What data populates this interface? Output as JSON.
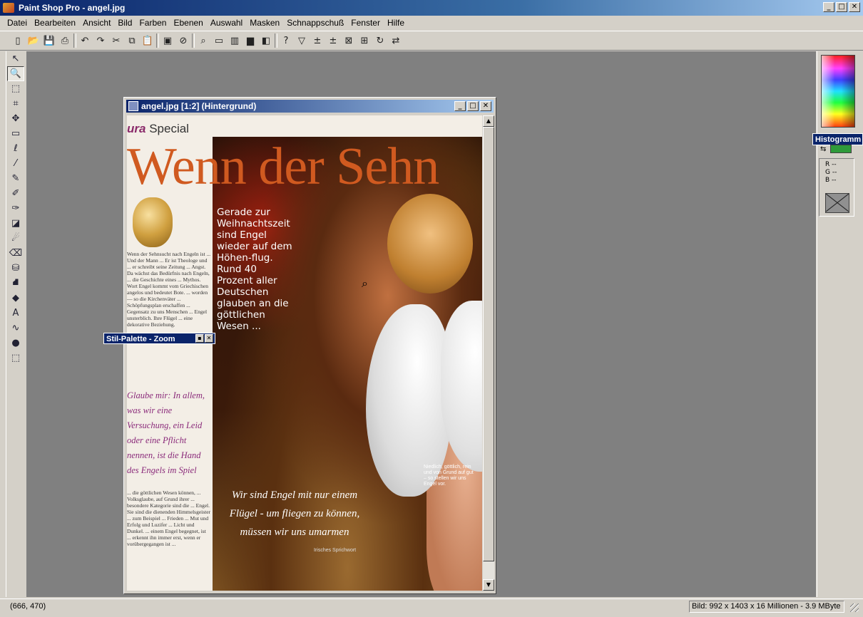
{
  "app": {
    "title": "Paint Shop Pro - angel.jpg"
  },
  "menu": [
    "Datei",
    "Bearbeiten",
    "Ansicht",
    "Bild",
    "Farben",
    "Ebenen",
    "Auswahl",
    "Masken",
    "Schnappschuß",
    "Fenster",
    "Hilfe"
  ],
  "toolbar_icons": [
    {
      "name": "new-icon",
      "glyph": "▯"
    },
    {
      "name": "open-icon",
      "glyph": "📂"
    },
    {
      "name": "save-icon",
      "glyph": "💾"
    },
    {
      "name": "print-icon",
      "glyph": "⎙"
    },
    {
      "name": "sep"
    },
    {
      "name": "undo-icon",
      "glyph": "↶"
    },
    {
      "name": "redo-icon",
      "glyph": "↷"
    },
    {
      "name": "cut-icon",
      "glyph": "✂"
    },
    {
      "name": "copy-icon",
      "glyph": "⧉"
    },
    {
      "name": "paste-icon",
      "glyph": "📋"
    },
    {
      "name": "sep"
    },
    {
      "name": "full-screen-icon",
      "glyph": "▣"
    },
    {
      "name": "normal-view-icon",
      "glyph": "⊘"
    },
    {
      "name": "sep"
    },
    {
      "name": "zoom-toggle-icon",
      "glyph": "⌕"
    },
    {
      "name": "toolbar-toggle-icon",
      "glyph": "▭"
    },
    {
      "name": "color-palette-icon",
      "glyph": "▥"
    },
    {
      "name": "histogram-icon",
      "glyph": "▆"
    },
    {
      "name": "layer-palette-icon",
      "glyph": "◧"
    },
    {
      "name": "sep"
    },
    {
      "name": "context-help-icon",
      "glyph": "?"
    },
    {
      "name": "filter-icon",
      "glyph": "▽"
    },
    {
      "name": "brightness-icon",
      "glyph": "±"
    },
    {
      "name": "contrast-icon",
      "glyph": "±"
    },
    {
      "name": "grid-icon",
      "glyph": "⊠"
    },
    {
      "name": "lock-icon",
      "glyph": "⊞"
    },
    {
      "name": "rotate-icon",
      "glyph": "↻"
    },
    {
      "name": "resize-icon",
      "glyph": "⇄"
    }
  ],
  "tools": [
    {
      "name": "arrow-tool-icon",
      "glyph": "↖"
    },
    {
      "name": "zoom-tool-icon",
      "glyph": "🔍",
      "active": true
    },
    {
      "name": "deform-tool-icon",
      "glyph": "⬚"
    },
    {
      "name": "crop-tool-icon",
      "glyph": "⌗"
    },
    {
      "name": "mover-tool-icon",
      "glyph": "✥"
    },
    {
      "name": "selection-tool-icon",
      "glyph": "▭"
    },
    {
      "name": "freehand-tool-icon",
      "glyph": "ℓ"
    },
    {
      "name": "dropper-tool-icon",
      "glyph": "⁄"
    },
    {
      "name": "paintbrush-tool-icon",
      "glyph": "✎"
    },
    {
      "name": "clone-tool-icon",
      "glyph": "✐"
    },
    {
      "name": "scratch-remover-icon",
      "glyph": "✑"
    },
    {
      "name": "color-replacer-icon",
      "glyph": "◪"
    },
    {
      "name": "retouch-tool-icon",
      "glyph": "☄"
    },
    {
      "name": "eraser-tool-icon",
      "glyph": "⌫"
    },
    {
      "name": "picture-tube-icon",
      "glyph": "⛁"
    },
    {
      "name": "airbrush-tool-icon",
      "glyph": "⛘"
    },
    {
      "name": "flood-fill-icon",
      "glyph": "◆"
    },
    {
      "name": "text-tool-icon",
      "glyph": "A"
    },
    {
      "name": "draw-tool-icon",
      "glyph": "∿"
    },
    {
      "name": "preset-shapes-icon",
      "glyph": "●"
    },
    {
      "name": "object-selector-icon",
      "glyph": "⬚"
    }
  ],
  "doc": {
    "title": "angel.jpg [1:2] (Hintergrund)"
  },
  "article": {
    "special_prefix": "ura",
    "special": "Special",
    "heading": "Wenn der Sehn",
    "overlay": "Gerade zur Weihnachtszeit sind Engel wieder auf dem Höhen-flug. Rund 40 Prozent aller Deutschen glauben an die göttlichen Wesen ...",
    "quote": "Wir sind Engel mit nur einem Flügel - um fliegen zu können, müssen wir uns umarmen",
    "quote_source": "Irisches Sprichwort",
    "caption": "Niedlich, göttlich, rein und von Grund auf gut – so stellen wir uns Engel vor.",
    "column_text": "Wenn der Sehnsucht nach Engeln ist ... Und der Mann ... Er ist Theologe und ... er schreibt seine Zeitung ... Angst. Da wächst das Bedürfnis nach Engeln, ... die Geschichte eines ... Mythos. Wort Engel kommt vom Griechischen angelos und bedeutet Bote. ... worden — so die Kirchenväter ... Schöpfungsplan erschaffen ... Gegensatz zu uns Menschen ... Engel unsterblich. Ihre Flügel ... eine dekorative Beziehung.",
    "purple_quote": "Glaube mir: In allem, was wir eine Versuchung, ein Leid oder eine Pflicht nennen, ist die Hand des Engels im Spiel",
    "column_text2": "... die göttlichen Wesen können, ... Volksglaube, auf Grund ihrer ... besondere Kategorie sind die ... Engel. Sie sind die dienenden Himmelsgeister ... zum Beispiel ... Frieden ... Mut und Erfolg und Luzifer ... Licht und Dunkel. ... einem Engel begegnet, ist ... erkennt ihn immer erst, wenn er vorübergegangen ist ..."
  },
  "stil_palette": {
    "title": "Stil-Palette - Zoom"
  },
  "histogram_tip": "Histogramm",
  "rgb": [
    "R --",
    "G --",
    "B --"
  ],
  "status": {
    "coords": "(666, 470)",
    "image_info": "Bild:  992 x 1403 x 16 Millionen - 3.9 MByte"
  }
}
